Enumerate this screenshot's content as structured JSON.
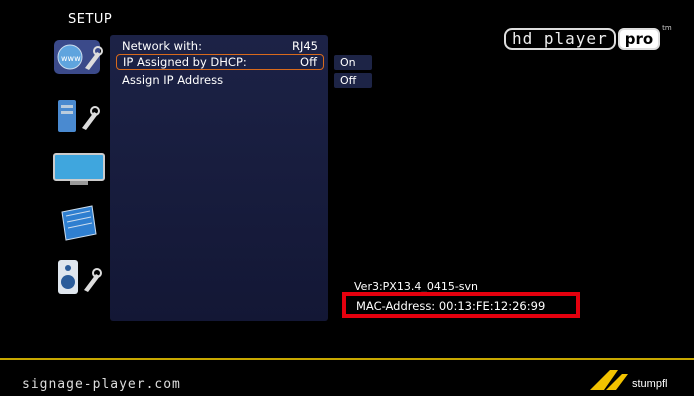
{
  "header": {
    "title": "SETUP"
  },
  "logo": {
    "hd_text": "hd player",
    "pro_text": "pro",
    "tm": "tm"
  },
  "sidebar": {
    "items": [
      {
        "icon": "network-settings-icon"
      },
      {
        "icon": "system-settings-icon"
      },
      {
        "icon": "display-icon"
      },
      {
        "icon": "book-icon"
      },
      {
        "icon": "audio-settings-icon"
      }
    ]
  },
  "menu": {
    "rows": [
      {
        "label": "Network with:",
        "value": "RJ45"
      },
      {
        "label": "IP Assigned by DHCP:",
        "value": "Off"
      },
      {
        "label": "Assign IP Address",
        "value": ""
      }
    ],
    "options": [
      "On",
      "Off"
    ]
  },
  "status": {
    "version": "Ver3:PX13.4_0415-svn",
    "mac_address": "MAC-Address: 00:13:FE:12:26:99"
  },
  "footer": {
    "url": "signage-player.com",
    "brand": "stumpfl"
  },
  "colors": {
    "accent": "#d86a1c",
    "highlight": "#e5000e",
    "separator": "#c8a800"
  }
}
